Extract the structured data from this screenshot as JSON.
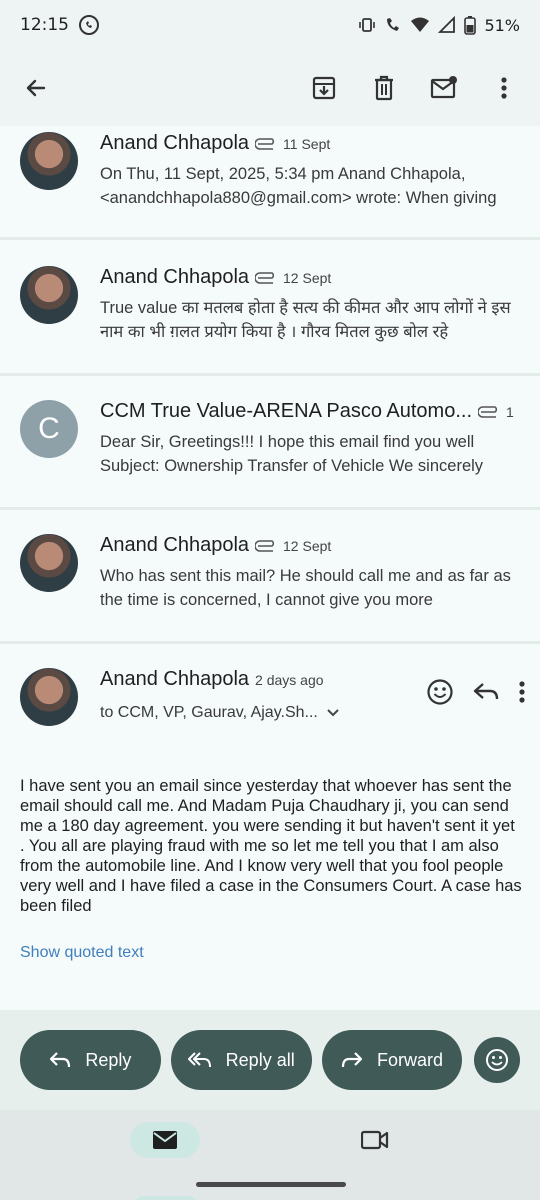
{
  "status_bar": {
    "time": "12:15",
    "battery": "51%"
  },
  "app_bar": {
    "back_icon": "arrow-back-icon",
    "archive_icon": "archive-icon",
    "delete_icon": "trash-icon",
    "mark_unread_icon": "mail-unread-icon",
    "more_icon": "more-vert-icon"
  },
  "messages": [
    {
      "sender": "Anand Chhapola",
      "date": "11 Sept",
      "has_attachment": true,
      "avatar": "photo",
      "snippet": "On Thu, 11 Sept, 2025, 5:34 pm Anand Chhapola, <anandchhapola880@gmail.com> wrote: When giving"
    },
    {
      "sender": "Anand Chhapola",
      "date": "12 Sept",
      "has_attachment": true,
      "avatar": "photo",
      "snippet": "True value का मतलब होता है सत्य की कीमत और आप लोगों ने इस नाम का भी ग़लत प्रयोग किया है । गौरव मितल कुछ बोल रहे"
    },
    {
      "sender": "CCM True Value-ARENA Pasco Automo...",
      "date": "1",
      "has_attachment": true,
      "avatar": "letter",
      "avatar_letter": "C",
      "snippet": "Dear Sir, Greetings!!! I hope this email find you well Subject: Ownership Transfer of Vehicle We sincerely"
    },
    {
      "sender": "Anand Chhapola",
      "date": "12 Sept",
      "has_attachment": true,
      "avatar": "photo",
      "snippet": "Who has sent this mail? He should call me and as far as the time is concerned, I cannot give you more"
    }
  ],
  "open_message": {
    "sender": "Anand Chhapola",
    "date": "2 days ago",
    "recipients": "to CCM, VP, Gaurav, Ajay.Sh...",
    "body": "I have sent you an email since yesterday that whoever has sent the email should call me. And Madam Puja Chaudhary ji, you can send me a 180 day agreement. you were sending it but haven't sent it yet . You all are playing fraud with me so let me tell you that I am also from the automobile line. And I know very well that you fool people very well and I have filed a case in the Consumers Court. A case has been filed",
    "show_quoted": "Show quoted text"
  },
  "actions": {
    "reply": "Reply",
    "reply_all": "Reply all",
    "forward": "Forward"
  },
  "colors": {
    "background": "#f0f5f4",
    "pill": "#3f5a57",
    "link": "#3f7fbf",
    "nav_active": "#cde8e3"
  }
}
